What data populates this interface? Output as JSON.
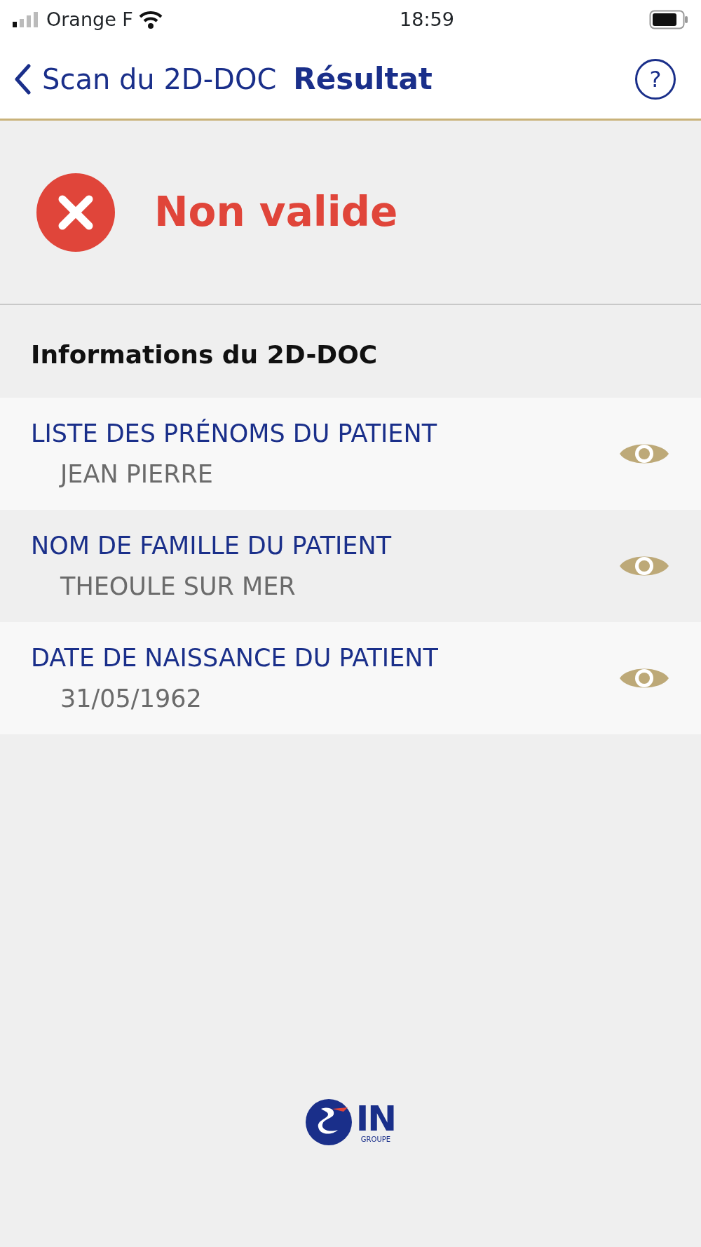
{
  "status_bar": {
    "carrier": "Orange F",
    "time": "18:59"
  },
  "nav": {
    "back_label": "Scan du 2D-DOC",
    "title": "Résultat",
    "help": "?"
  },
  "result": {
    "valid": false,
    "label": "Non valide"
  },
  "section_title": "Informations du 2D-DOC",
  "fields": [
    {
      "label": "LISTE DES PRÉNOMS DU PATIENT",
      "value": "JEAN PIERRE"
    },
    {
      "label": "NOM DE FAMILLE DU PATIENT",
      "value": "THEOULE SUR MER"
    },
    {
      "label": "DATE DE NAISSANCE DU PATIENT",
      "value": "31/05/1962"
    }
  ],
  "logo": {
    "name": "IN",
    "subtitle": "GROUPE"
  }
}
